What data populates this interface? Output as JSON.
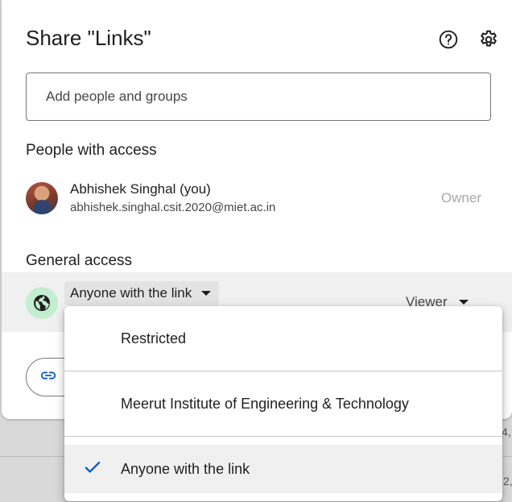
{
  "dialog": {
    "title": "Share \"Links\"",
    "help_icon": "help-circle-icon",
    "settings_icon": "gear-icon"
  },
  "add_people": {
    "placeholder": "Add people and groups"
  },
  "people_with_access": {
    "heading": "People with access",
    "person": {
      "name": "Abhishek Singhal (you)",
      "email": "abhishek.singhal.csit.2020@miet.ac.in",
      "role": "Owner"
    }
  },
  "general_access": {
    "heading": "General access",
    "selected": "Anyone with the link",
    "role": "Viewer",
    "icon": "globe-icon"
  },
  "copy_link": {
    "icon": "link-icon"
  },
  "access_menu": {
    "items": [
      {
        "label": "Restricted",
        "checked": false
      },
      {
        "label": "Meerut Institute of Engineering & Technology",
        "checked": false
      },
      {
        "label": "Anyone with the link",
        "checked": true
      }
    ]
  },
  "background": {
    "fragment_1": "4,",
    "fragment_2": "2,"
  },
  "colors": {
    "accent": "#0b57d0",
    "globe_bg": "#c4eed0",
    "selected_row": "#f0f0f0"
  }
}
